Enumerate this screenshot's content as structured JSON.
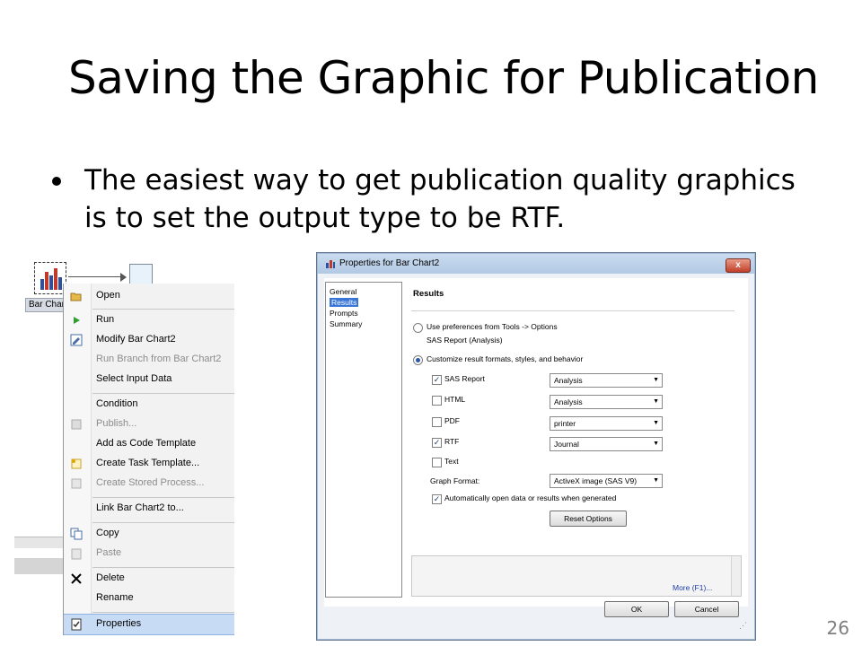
{
  "slide": {
    "title": "Saving the Graphic for Publication",
    "bullet": "The easiest way to get publication quality graphics is to set the output type to be RTF.",
    "page_number": "26"
  },
  "flow": {
    "node_label": "Bar Chart2"
  },
  "context_menu": {
    "items": [
      {
        "label": "Open",
        "icon": "open-folder-icon",
        "disabled": false
      },
      {
        "label": "Run",
        "icon": "run-play-icon",
        "disabled": false
      },
      {
        "label": "Modify Bar Chart2",
        "icon": "modify-icon",
        "disabled": false
      },
      {
        "label": "Run Branch from Bar Chart2",
        "icon": "",
        "disabled": true
      },
      {
        "label": "Select Input Data",
        "icon": "",
        "disabled": false
      },
      {
        "label": "Condition",
        "icon": "",
        "disabled": false
      },
      {
        "label": "Publish...",
        "icon": "publish-icon",
        "disabled": true
      },
      {
        "label": "Add as Code Template",
        "icon": "",
        "disabled": false
      },
      {
        "label": "Create Task Template...",
        "icon": "task-template-icon",
        "disabled": false
      },
      {
        "label": "Create Stored Process...",
        "icon": "stored-process-icon",
        "disabled": true
      },
      {
        "label": "Link Bar Chart2 to...",
        "icon": "",
        "disabled": false
      },
      {
        "label": "Copy",
        "icon": "copy-icon",
        "disabled": false
      },
      {
        "label": "Paste",
        "icon": "paste-icon",
        "disabled": true
      },
      {
        "label": "Delete",
        "icon": "delete-x-icon",
        "disabled": false
      },
      {
        "label": "Rename",
        "icon": "",
        "disabled": false
      },
      {
        "label": "Properties",
        "icon": "properties-icon",
        "disabled": false,
        "selected": true
      }
    ]
  },
  "dialog": {
    "title": "Properties for Bar Chart2",
    "close_label": "x",
    "nav": [
      "General",
      "Results",
      "Prompts",
      "Summary"
    ],
    "nav_selected": "Results",
    "section_title": "Results",
    "option_preferences": "Use preferences from Tools -> Options",
    "preferences_sub": "SAS Report (Analysis)",
    "option_customize": "Customize result formats, styles, and behavior",
    "formats": [
      {
        "label": "SAS Report",
        "checked": true,
        "style": "Analysis"
      },
      {
        "label": "HTML",
        "checked": false,
        "style": "Analysis"
      },
      {
        "label": "PDF",
        "checked": false,
        "style": "printer"
      },
      {
        "label": "RTF",
        "checked": true,
        "style": "Journal"
      },
      {
        "label": "Text",
        "checked": false,
        "style": ""
      }
    ],
    "graph_format_label": "Graph Format:",
    "graph_format_value": "ActiveX image (SAS V9)",
    "auto_open_label": "Automatically open data or results when generated",
    "reset_button": "Reset Options",
    "more_link": "More (F1)...",
    "ok_button": "OK",
    "cancel_button": "Cancel"
  }
}
